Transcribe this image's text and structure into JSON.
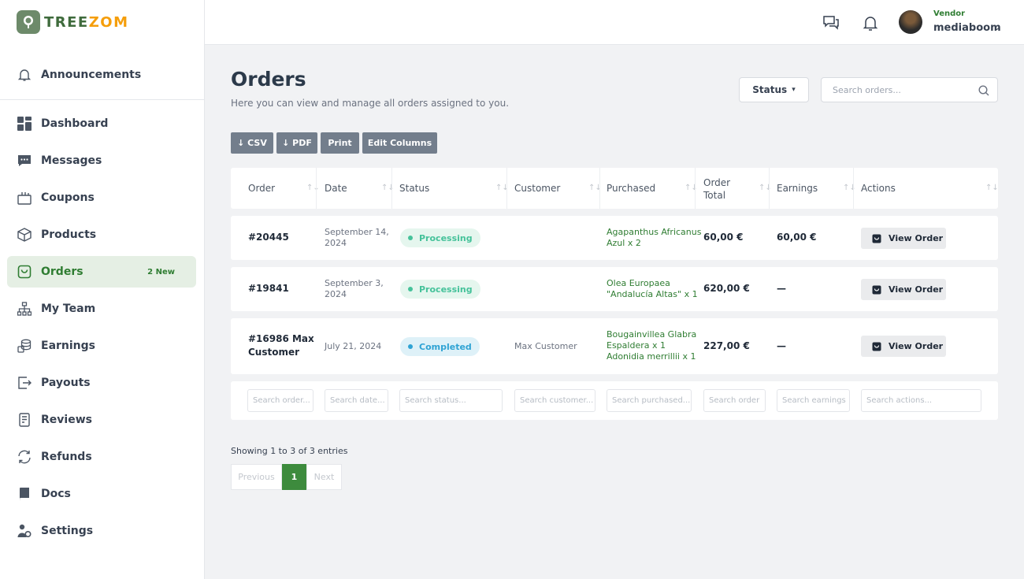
{
  "brand": {
    "tree": "TREE",
    "zom": "ZOM"
  },
  "sidebar": {
    "announcements": "Announcements",
    "items": [
      {
        "label": "Dashboard",
        "icon": "dashboard-icon"
      },
      {
        "label": "Messages",
        "icon": "messages-icon"
      },
      {
        "label": "Coupons",
        "icon": "coupons-icon"
      },
      {
        "label": "Products",
        "icon": "products-icon"
      },
      {
        "label": "Orders",
        "icon": "orders-icon",
        "badge": "2 New",
        "active": true
      },
      {
        "label": "My Team",
        "icon": "team-icon"
      },
      {
        "label": "Earnings",
        "icon": "earnings-icon"
      },
      {
        "label": "Payouts",
        "icon": "payouts-icon"
      },
      {
        "label": "Reviews",
        "icon": "reviews-icon"
      },
      {
        "label": "Refunds",
        "icon": "refunds-icon"
      },
      {
        "label": "Docs",
        "icon": "docs-icon"
      },
      {
        "label": "Settings",
        "icon": "settings-icon"
      }
    ]
  },
  "topbar": {
    "role": "Vendor",
    "username": "mediaboom"
  },
  "page": {
    "title": "Orders",
    "subtitle": "Here you can view and manage all orders assigned to you.",
    "status_filter": "Status",
    "search_placeholder": "Search orders..."
  },
  "toolbar": {
    "csv": "↓ CSV",
    "pdf": "↓ PDF",
    "print": "Print",
    "edit_columns": "Edit Columns"
  },
  "table": {
    "headers": {
      "order": "Order",
      "date": "Date",
      "status": "Status",
      "customer": "Customer",
      "purchased": "Purchased",
      "order_total_1": "Order",
      "order_total_2": "Total",
      "earnings": "Earnings",
      "actions": "Actions"
    },
    "rows": [
      {
        "order_1": "#20445",
        "order_2": "",
        "date_1": "September 14,",
        "date_2": "2024",
        "status": "Processing",
        "customer": "",
        "purchased_1": "Agapanthus Africanus",
        "purchased_2": "Azul x 2",
        "purchased_3": "",
        "total": "60,00 €",
        "earnings": "60,00 €",
        "action": "View Order"
      },
      {
        "order_1": "#19841",
        "order_2": "",
        "date_1": "September 3,",
        "date_2": "2024",
        "status": "Processing",
        "customer": "",
        "purchased_1": "Olea Europaea",
        "purchased_2": "\"Andalucía Altas\" x 1",
        "purchased_3": "",
        "total": "620,00 €",
        "earnings": "—",
        "action": "View Order"
      },
      {
        "order_1": "#16986 Max",
        "order_2": "Customer",
        "date_1": "July 21, 2024",
        "date_2": "",
        "status": "Completed",
        "customer": "Max Customer",
        "purchased_1": "Bougainvillea Glabra",
        "purchased_2": "Espaldera x 1",
        "purchased_3": "Adonidia merrillii x 1",
        "total": "227,00 €",
        "earnings": "—",
        "action": "View Order"
      }
    ],
    "filters": {
      "order": "Search order...",
      "date": "Search date...",
      "status": "Search status...",
      "customer": "Search customer...",
      "purchased": "Search purchased...",
      "total": "Search order",
      "earnings": "Search earnings",
      "actions": "Search actions..."
    }
  },
  "pagination": {
    "info": "Showing 1 to 3 of 3 entries",
    "previous": "Previous",
    "current": "1",
    "next": "Next"
  },
  "colors": {
    "brand_green": "#2f7d32",
    "brand_orange": "#f59e0b",
    "active_bg": "#e5efe4"
  }
}
